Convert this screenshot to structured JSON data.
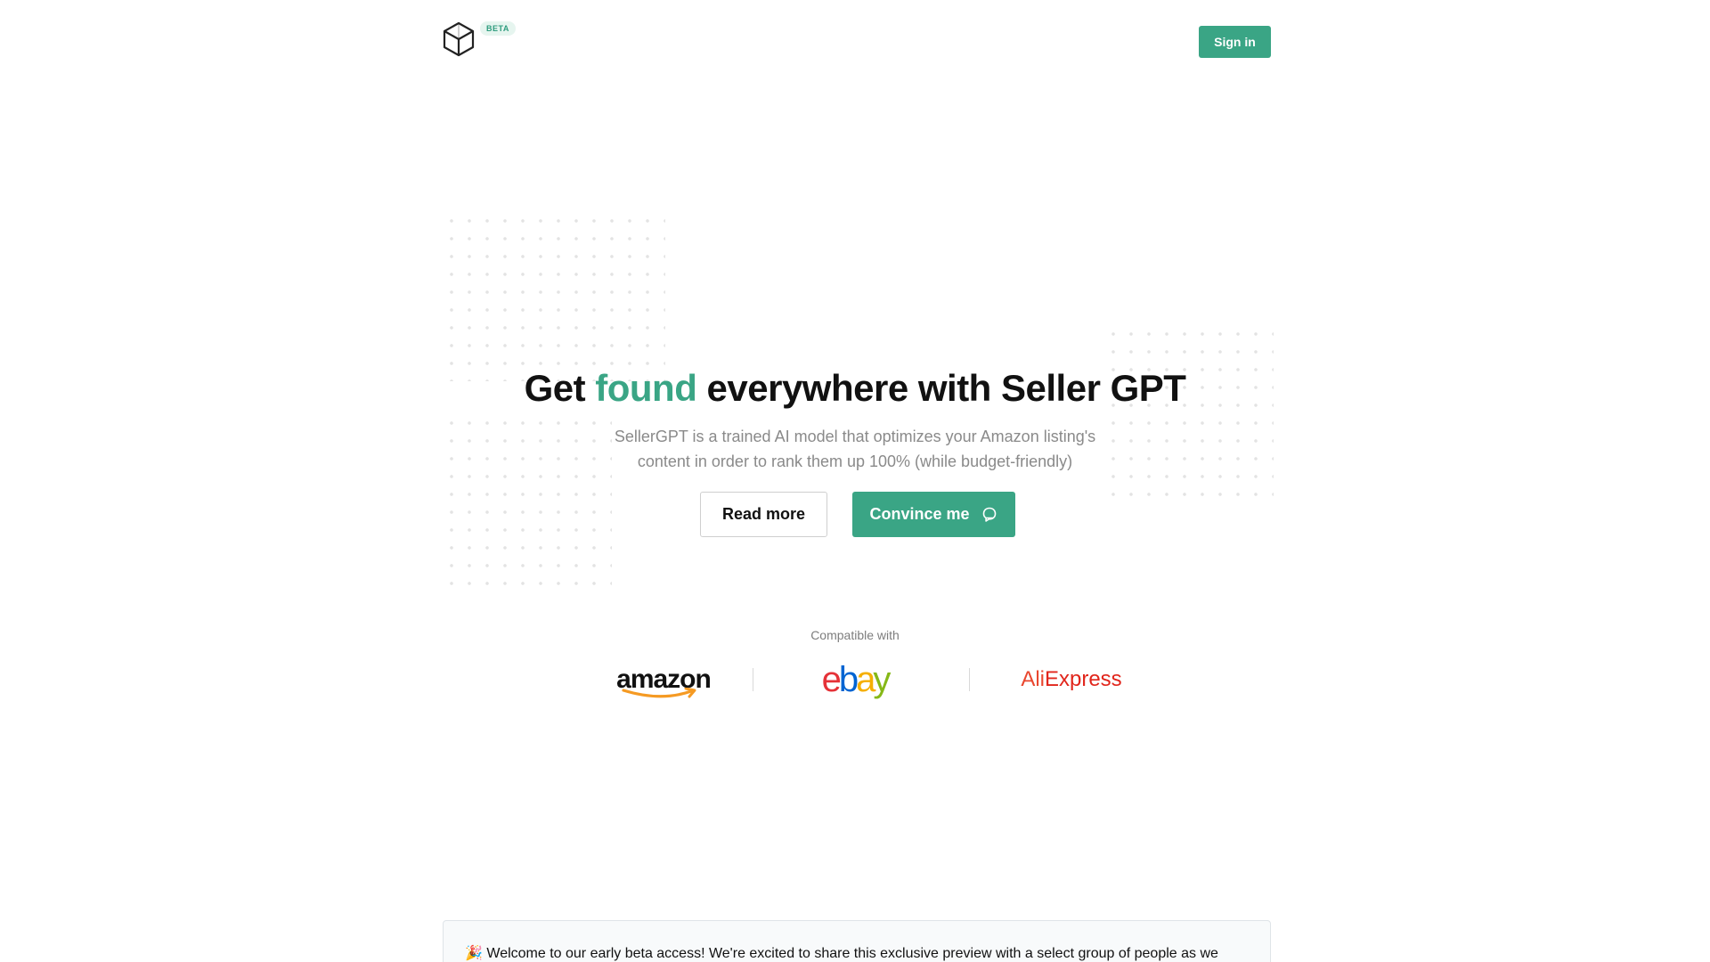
{
  "header": {
    "logo_icon": "cube-icon",
    "beta_badge": "BETA",
    "signin_label": "Sign in"
  },
  "hero": {
    "title_before": "Get ",
    "title_accent": "found",
    "title_after": " everywhere with Seller GPT",
    "subtitle_line1": "SellerGPT is a trained AI model that optimizes your Amazon listing's",
    "subtitle_line2": "content in order to rank them up 100% (while budget-friendly)",
    "read_more_label": "Read more",
    "convince_label": "Convince me",
    "convince_icon": "chat-bubble-icon"
  },
  "compatible": {
    "label": "Compatible with",
    "logos": [
      {
        "name": "amazon",
        "text": "amazon"
      },
      {
        "name": "ebay",
        "letters": [
          "e",
          "b",
          "a",
          "y"
        ]
      },
      {
        "name": "aliexpress",
        "part1": "Ali",
        "part2": "Express"
      }
    ]
  },
  "banner": {
    "emoji": "🎉",
    "text": "Welcome to our early beta access! We're excited to share this exclusive preview with a select group of people as we"
  },
  "colors": {
    "accent": "#3aa585",
    "ebay_e": "#e53238",
    "ebay_b": "#0064d2",
    "ebay_a": "#f5af02",
    "ebay_y": "#86b817",
    "aliexpress": "#e9472f"
  }
}
